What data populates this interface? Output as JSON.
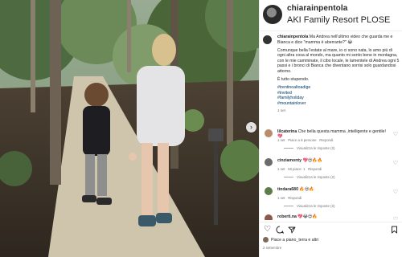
{
  "post": {
    "username": "chiarainpentola",
    "location": "AKI Family Resort PLOSE"
  },
  "caption": {
    "username": "chiarainpentola",
    "paragraph1": "Ma Andrea nell'ultimo video che guarda me e Bianca e dice \"mamma è aberrante?\" 😂",
    "paragraph2": "Comunque bella l'estate al mare, io ci sono nata, lo amo più di ogni altra cosa al mondo, ma quanto mi sento bene in montagna, con le mie camminate, il cibo locale, le lamentele di Andrea ogni 5 passi e i bronci di Bianca che diventano sorrisi solo guardandosi attorno.",
    "paragraph3": "È tutto stupendo.",
    "hashtags": [
      "#trentinoaltoadige",
      "#invited",
      "#familyholiday",
      "#mountainlover"
    ],
    "time": "1 set"
  },
  "comments": [
    {
      "username": "lilcaterina",
      "text": "Che bella questa mamma ,intelligente e gentile! 💖",
      "time": "1 set",
      "likes": "Piace a 8 persone",
      "reply": "Rispondi",
      "view_replies": "Visualizza le risposte (2)",
      "avatar_color": "#b98c6a"
    },
    {
      "username": "cinziamonty",
      "text": "💖😍🔥🔥",
      "time": "1 set",
      "likes": "Mi piace: 1",
      "reply": "Rispondi",
      "view_replies": "Visualizza le risposte (2)",
      "avatar_color": "#6b6b6b"
    },
    {
      "username": "tindara680",
      "text": "🔥😍🔥",
      "time": "1 set",
      "likes": "",
      "reply": "Rispondi",
      "view_replies": "Visualizza le risposte (2)",
      "avatar_color": "#5a7d4a"
    },
    {
      "username": "roberti.na",
      "text": "💖😂😍🔥",
      "time": "",
      "likes": "",
      "reply": "",
      "view_replies": "",
      "avatar_color": "#8a5a4a"
    }
  ],
  "likes_text": "Piace a piano_terra e altri",
  "date": "2 settembre",
  "icons": {
    "like": "heart-icon",
    "comment": "comment-icon",
    "share": "send-icon",
    "save": "bookmark-icon",
    "next": "chevron-right-icon"
  }
}
